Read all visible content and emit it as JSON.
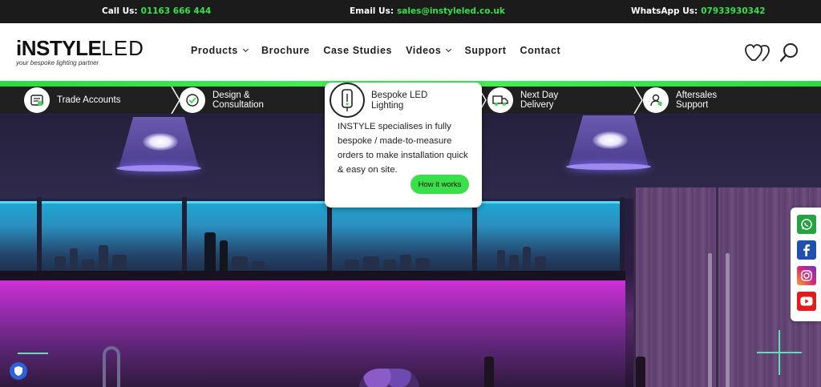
{
  "topbar": {
    "call_label": "Call Us:",
    "call_value": "01163 666 444",
    "email_label": "Email Us:",
    "email_value": "sales@instyleled.co.uk",
    "whatsapp_label": "WhatsApp Us:",
    "whatsapp_value": "07933930342"
  },
  "logo": {
    "brand_main": "iNSTYLE",
    "brand_led": "LED",
    "tagline": "your bespoke lighting partner"
  },
  "nav": {
    "items": [
      {
        "label": "Products",
        "dropdown": true
      },
      {
        "label": "Brochure",
        "dropdown": false
      },
      {
        "label": "Case Studies",
        "dropdown": false
      },
      {
        "label": "Videos",
        "dropdown": true
      },
      {
        "label": "Support",
        "dropdown": false
      },
      {
        "label": "Contact",
        "dropdown": false
      }
    ]
  },
  "header_icons": [
    "favourites-icon",
    "search-icon"
  ],
  "features": [
    {
      "label": "Trade Accounts",
      "icon": "trade-accounts-icon"
    },
    {
      "label": "Design &\nConsultation",
      "icon": "design-consultation-icon"
    },
    {
      "label": "Bespoke LED\nLighting",
      "icon": "bespoke-lighting-icon"
    },
    {
      "label": "Next Day\nDelivery",
      "icon": "delivery-van-icon"
    },
    {
      "label": "Aftersales\nSupport",
      "icon": "aftersales-support-icon"
    }
  ],
  "popup": {
    "title": "Bespoke LED\nLighting",
    "body": "INSTYLE specialises in fully bespoke / made-to-measure orders to make installation quick & easy on site.",
    "button": "How it works"
  },
  "social": [
    {
      "name": "whatsapp",
      "color": "#25a244"
    },
    {
      "name": "facebook",
      "color": "#1f4fb0"
    },
    {
      "name": "instagram",
      "color": "#d62976"
    },
    {
      "name": "youtube",
      "color": "#e21b1b"
    }
  ],
  "colors": {
    "accent_green": "#39e04a",
    "topbar_bg": "#1b1b1b",
    "ribbon_bg": "#202020"
  }
}
